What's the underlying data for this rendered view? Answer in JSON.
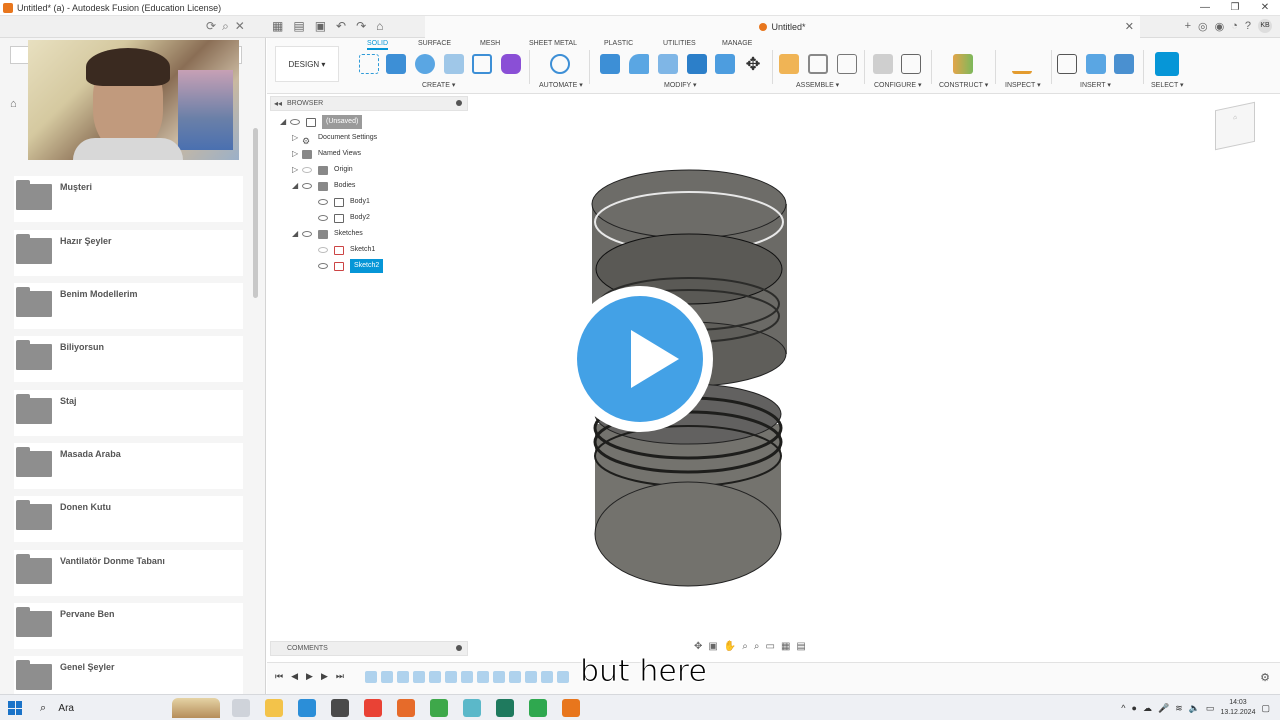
{
  "window": {
    "title": "Untitled* (a) - Autodesk Fusion (Education License)",
    "controls": [
      "—",
      "❐",
      "✕"
    ]
  },
  "tabstrip": {
    "doc_tab_label": "Untitled*",
    "close_glyph": "✕",
    "avatar_initials": "KB"
  },
  "data_panel": {
    "folders": [
      {
        "name": "Muşteri"
      },
      {
        "name": "Hazır Şeyler"
      },
      {
        "name": "Benim Modellerim"
      },
      {
        "name": "Biliyorsun"
      },
      {
        "name": "Staj"
      },
      {
        "name": "Masada Araba"
      },
      {
        "name": "Donen Kutu"
      },
      {
        "name": "Vantilatör Donme Tabanı"
      },
      {
        "name": "Pervane Ben"
      },
      {
        "name": "Genel Şeyler"
      }
    ]
  },
  "toolbar": {
    "workspace_button": "DESIGN ▾",
    "workspace_tabs": [
      {
        "label": "SOLID",
        "active": true
      },
      {
        "label": "SURFACE",
        "active": false
      },
      {
        "label": "MESH",
        "active": false
      },
      {
        "label": "SHEET METAL",
        "active": false
      },
      {
        "label": "PLASTIC",
        "active": false
      },
      {
        "label": "UTILITIES",
        "active": false
      },
      {
        "label": "MANAGE",
        "active": false
      }
    ],
    "groups": [
      {
        "label": "CREATE ▾"
      },
      {
        "label": "AUTOMATE ▾"
      },
      {
        "label": "MODIFY ▾"
      },
      {
        "label": "ASSEMBLE ▾"
      },
      {
        "label": "CONFIGURE ▾"
      },
      {
        "label": "CONSTRUCT ▾"
      },
      {
        "label": "INSPECT ▾"
      },
      {
        "label": "INSERT ▾"
      },
      {
        "label": "SELECT ▾"
      }
    ],
    "accent_color": "#0696d7"
  },
  "browser": {
    "title": "BROWSER",
    "collapse_glyph": "◂◂",
    "items": [
      {
        "label": "(Unsaved)",
        "arrow": "◢"
      },
      {
        "label": "Document Settings",
        "arrow": "▷"
      },
      {
        "label": "Named Views",
        "arrow": "▷"
      },
      {
        "label": "Origin",
        "arrow": "▷"
      },
      {
        "label": "Bodies",
        "arrow": "◢"
      },
      {
        "label": "Body1",
        "arrow": ""
      },
      {
        "label": "Body2",
        "arrow": ""
      },
      {
        "label": "Sketches",
        "arrow": "◢"
      },
      {
        "label": "Sketch1",
        "arrow": ""
      },
      {
        "label": "Sketch2",
        "arrow": ""
      }
    ]
  },
  "comments": {
    "title": "COMMENTS"
  },
  "caption": {
    "text": "but here"
  },
  "taskbar": {
    "search_placeholder": "Ara",
    "time": "14:03",
    "date": "13.12.2024"
  }
}
